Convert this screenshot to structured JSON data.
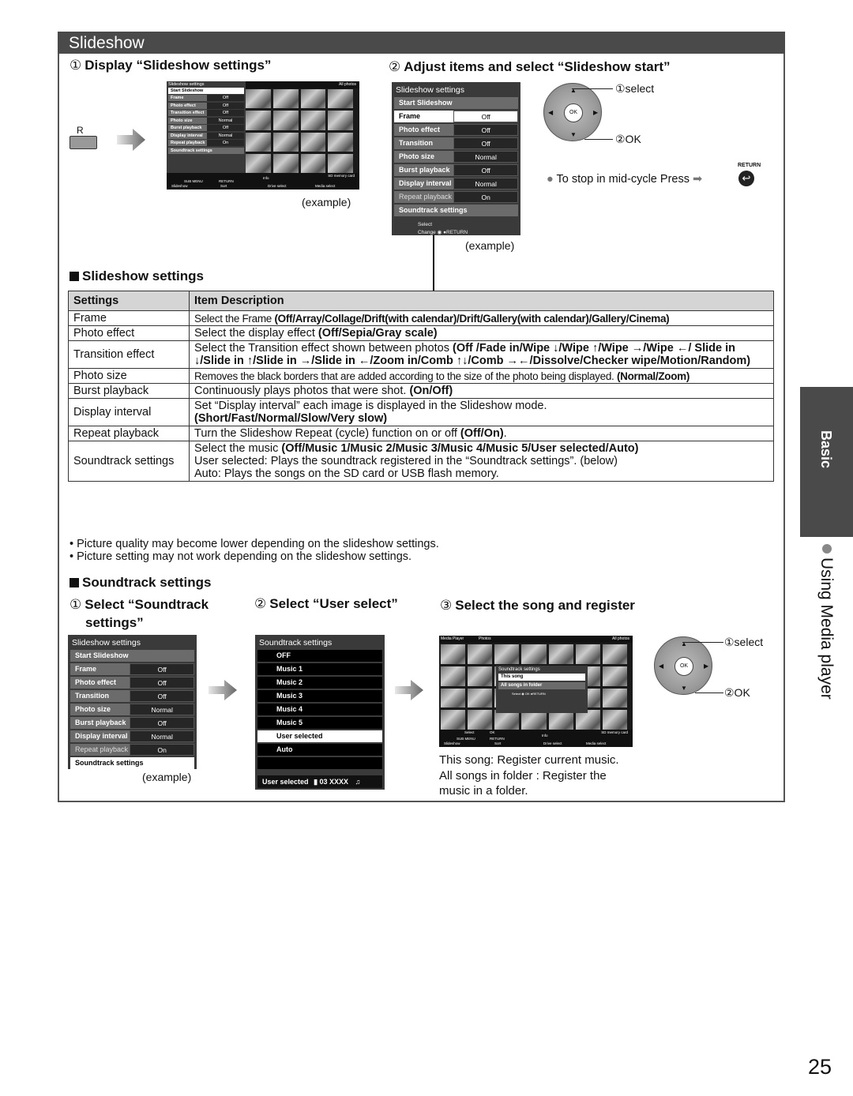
{
  "page": {
    "section_title": "Slideshow",
    "page_number": "25",
    "side_tab": "Basic",
    "side_section": "Using Media player"
  },
  "step1": {
    "num": "①",
    "heading": "Display “Slideshow settings”",
    "button_label": "R",
    "example": "(example)",
    "screen": {
      "menu_title": "Slideshow settings",
      "header_right": "All photos",
      "start": "Start Slideshow",
      "rows": [
        {
          "label": "Frame",
          "value": "Off"
        },
        {
          "label": "Photo effect",
          "value": "Off"
        },
        {
          "label": "Transition effect",
          "value": "Off"
        },
        {
          "label": "Photo size",
          "value": "Normal"
        },
        {
          "label": "Burst playback",
          "value": "Off"
        },
        {
          "label": "Display interval",
          "value": "Normal"
        },
        {
          "label": "Repeat playback",
          "value": "On"
        }
      ],
      "soundtrack": "Soundtrack settings",
      "foot_card": "SD memory card",
      "foot_info": "Info",
      "foot_submenu": "SUB MENU",
      "foot_return": "RETURN",
      "foot_items": [
        "Slideshow",
        "Sort",
        "Drive select",
        "Media select"
      ]
    }
  },
  "step2": {
    "num": "②",
    "heading": "Adjust items and select “Slideshow start”",
    "example": "(example)",
    "menu": {
      "title": "Slideshow settings",
      "start": "Start Slideshow",
      "rows": [
        {
          "label": "Frame",
          "value": "Off"
        },
        {
          "label": "Photo effect",
          "value": "Off"
        },
        {
          "label": "Transition effect",
          "value": "Off"
        },
        {
          "label": "Photo size",
          "value": "Normal"
        },
        {
          "label": "Burst playback",
          "value": "Off"
        },
        {
          "label": "Display interval",
          "value": "Normal"
        },
        {
          "label": "Repeat playback",
          "value": "On"
        }
      ],
      "soundtrack": "Soundtrack settings",
      "foot_select": "Select",
      "foot_change": "Change",
      "foot_return": "RETURN"
    },
    "remote": {
      "ok": "OK",
      "select_label": "①select",
      "ok_label": "②OK"
    },
    "stop_note": "To stop in mid-cycle Press",
    "return_label": "RETURN"
  },
  "settings_section": {
    "heading": "Slideshow settings",
    "columns": [
      "Settings",
      "Item Description"
    ],
    "rows": [
      {
        "setting": "Frame",
        "desc": "Select the Frame ",
        "opts": "(Off/Array/Collage/Drift(with calendar)/Drift/Gallery(with calendar)/Gallery/Cinema)"
      },
      {
        "setting": "Photo effect",
        "desc": "Select the display effect ",
        "opts": "(Off/Sepia/Gray scale)"
      },
      {
        "setting": "Transition effect",
        "desc": "Select the Transition effect shown between photos ",
        "opts": "(Off /Fade in/Wipe ↓/Wipe ↑/Wipe →/Wipe ←/ Slide in ↓/Slide in ↑/Slide in →/Slide in ←/Zoom in/Comb ↑↓/Comb →←/Dissolve/Checker wipe/Motion/Random)"
      },
      {
        "setting": "Photo size",
        "desc": "Removes the black borders that are added according to the size of the photo being displayed. ",
        "opts": "(Normal/Zoom)"
      },
      {
        "setting": "Burst playback",
        "desc": "Continuously plays photos that were shot. ",
        "opts": "(On/Off)"
      },
      {
        "setting": "Display interval",
        "desc": "Set “Display interval” each image is displayed in the Slideshow mode.",
        "opts": "(Short/Fast/Normal/Slow/Very slow)"
      },
      {
        "setting": "Repeat playback",
        "desc": "Turn the Slideshow Repeat (cycle) function on or off ",
        "opts": "(Off/On)",
        "tail": "."
      },
      {
        "setting": "Soundtrack settings",
        "desc": "Select the music ",
        "opts": "(Off/Music 1/Music 2/Music 3/Music 4/Music 5/User selected/Auto)",
        "line2": "User selected: Plays the soundtrack registered in the “Soundtrack settings”. (below)",
        "line3": "Auto: Plays the songs on the SD card or USB flash memory."
      }
    ],
    "notes": [
      "Picture quality may become lower depending on the slideshow settings.",
      "Picture setting may not work depending on the slideshow settings."
    ]
  },
  "soundtrack_section": {
    "heading": "Soundtrack settings",
    "step1": {
      "num": "①",
      "heading_line1": "Select “Soundtrack",
      "heading_line2": "settings”",
      "example": "(example)",
      "menu": {
        "title": "Slideshow settings",
        "start": "Start Slideshow",
        "rows": [
          {
            "label": "Frame",
            "value": "Off"
          },
          {
            "label": "Photo effect",
            "value": "Off"
          },
          {
            "label": "Transition effect",
            "value": "Off"
          },
          {
            "label": "Photo size",
            "value": "Normal"
          },
          {
            "label": "Burst playback",
            "value": "Off"
          },
          {
            "label": "Display interval",
            "value": "Normal"
          },
          {
            "label": "Repeat playback",
            "value": "On"
          }
        ],
        "soundtrack": "Soundtrack settings"
      }
    },
    "step2": {
      "num": "②",
      "heading": "Select “User select”",
      "menu": {
        "title": "Soundtrack settings",
        "items": [
          "OFF",
          "Music 1",
          "Music 2",
          "Music 3",
          "Music 4",
          "Music 5",
          "User selected",
          "Auto"
        ],
        "selected": "User selected",
        "footer_label": "User selected",
        "footer_track": "03 XXXX"
      }
    },
    "step3": {
      "num": "③",
      "heading": "Select the song and register",
      "screen": {
        "header_left": "Media Player",
        "header_mid": "Photos",
        "header_right": "All photos",
        "popup_title": "Soundtrack settings",
        "popup_items": [
          "This song",
          "All songs in folder"
        ],
        "popup_foot_select": "Select",
        "popup_foot_ok": "OK",
        "popup_foot_return": "RETURN",
        "foot_select": "Select",
        "foot_ok": "OK",
        "foot_submenu": "SUB MENU",
        "foot_return": "RETURN",
        "foot_info": "Info",
        "foot_card": "SD memory card",
        "foot_items": [
          "Slideshow",
          "Sort",
          "Drive select",
          "Media select"
        ]
      },
      "remote": {
        "ok": "OK",
        "select_label": "①select",
        "ok_label": "②OK"
      },
      "desc_lines": [
        "This song: Register current music.",
        "All songs in folder : Register the",
        "music in a folder."
      ]
    }
  }
}
